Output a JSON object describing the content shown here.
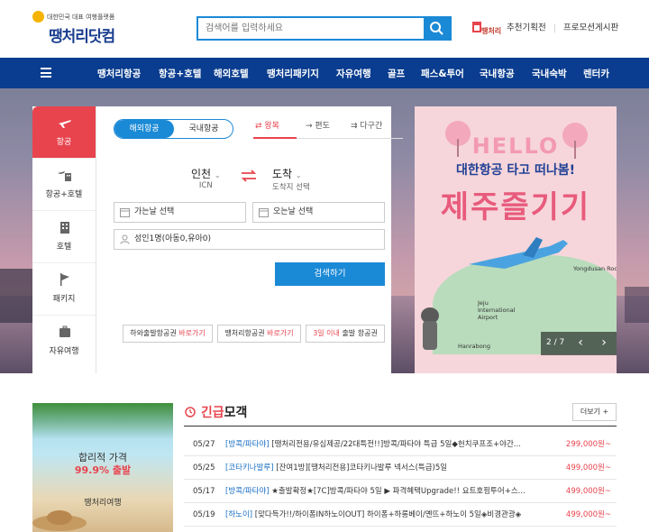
{
  "header": {
    "logo_tagline": "대한민국 대표 여행플랫폼",
    "logo_name": "땡처리닷컴",
    "search_placeholder": "검색어를 입력하세요",
    "mini_logo": "땡처리",
    "link1": "추천기획전",
    "link2": "프로모션게시판"
  },
  "nav": {
    "items": [
      "땡처리항공",
      "항공+호텔",
      "해외호텔",
      "땡처리패키지",
      "자유여행",
      "골프",
      "패스&투어",
      "국내항공",
      "국내숙박",
      "렌터카"
    ]
  },
  "sidebar": {
    "tabs": [
      {
        "label": "항공",
        "icon": "airplane-icon"
      },
      {
        "label": "항공+호텔",
        "icon": "plane-hotel-icon"
      },
      {
        "label": "호텔",
        "icon": "hotel-icon"
      },
      {
        "label": "패키지",
        "icon": "flag-icon"
      },
      {
        "label": "자유여행",
        "icon": "suitcase-icon"
      }
    ]
  },
  "booking": {
    "toggle_international": "해외항공",
    "toggle_domestic": "국내항공",
    "trip_roundtrip": "왕복",
    "trip_oneway": "편도",
    "trip_multicity": "다구간",
    "departure_city": "인천",
    "departure_code": "ICN",
    "arrival_city": "도착",
    "arrival_code": "도착지 선택",
    "depart_date": "가는날 선택",
    "return_date": "오는날 선택",
    "passengers": "성인1명(아동0,유아0)",
    "search_button": "검색하기",
    "chips": [
      {
        "text": "하와출발항공권 ",
        "red": "바로가기"
      },
      {
        "text": "땡처리항공권 ",
        "red": "바로가기"
      },
      {
        "text": " 출발 항공권",
        "red": "3일 이내"
      }
    ]
  },
  "promo": {
    "hello": "HELLO",
    "subtitle": "대한항공 타고 떠나봄!",
    "headline": "제주즐기기",
    "label_airport": "Jeju International Airport",
    "label_hanrabong": "Hanrabong",
    "label_peak": "Yongdusan Rock",
    "pager": "2 / 7"
  },
  "banner": {
    "line1": "합리적 가격",
    "line2": "99.9% 출발",
    "brand": "땡처리여행"
  },
  "deals": {
    "title_red": "긴급",
    "title_rest": "모객",
    "more": "더보기 +",
    "rows": [
      {
        "date": "05/27",
        "tag": "[방콕/파타야]",
        "title": " [땡처리전용/유심제공/22대특전!!]방콕/파타야 특급 5일◆헌치쿠프조+야간...",
        "price": "299,000원~"
      },
      {
        "date": "05/25",
        "tag": "[코타키나발루]",
        "title": " [잔여1방][땡처리전용]코타키나발루 넥서스(특급)5일",
        "price": "499,000원~"
      },
      {
        "date": "05/17",
        "tag": "[방콕/파타야]",
        "title": " ★출발확정★[7C]방콕/파타야 5일 ▶ 파격혜택Upgrade!! 요트호핑투어+스...",
        "price": "499,000원~"
      },
      {
        "date": "05/19",
        "tag": "[하노이]",
        "title": " [맞다득가!!/하이퐁IN하노이OUT] 하이퐁+하롱베이/옌뜨+하노이 5일◈비경관광◈",
        "price": "499,000원~"
      }
    ]
  },
  "colors": {
    "brand_blue": "#1b8ad6",
    "nav_navy": "#0a3d8f",
    "accent_red": "#e8444e"
  }
}
